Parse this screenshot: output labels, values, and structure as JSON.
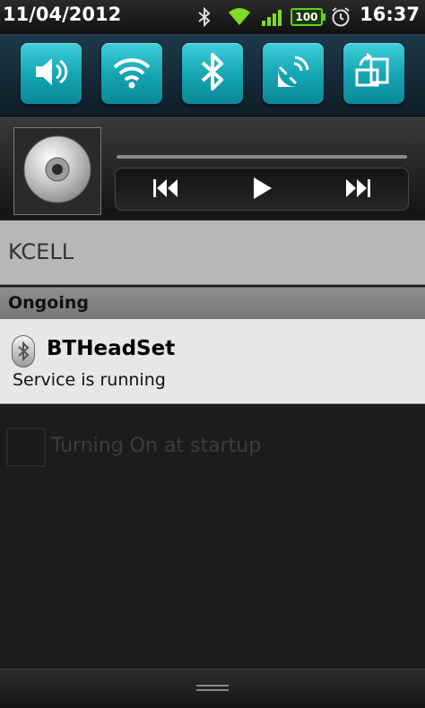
{
  "status_bar": {
    "date": "11/04/2012",
    "time": "16:37",
    "battery_level": "100",
    "icons": [
      "bluetooth-icon",
      "wifi-icon",
      "signal-icon",
      "battery-icon",
      "alarm-icon"
    ]
  },
  "quick_toggles": [
    {
      "name": "sound",
      "icon": "speaker-icon"
    },
    {
      "name": "wifi",
      "icon": "wifi-icon"
    },
    {
      "name": "bluetooth",
      "icon": "bluetooth-icon"
    },
    {
      "name": "gps",
      "icon": "satellite-icon"
    },
    {
      "name": "auto-rotate",
      "icon": "rotate-icon"
    }
  ],
  "music_widget": {
    "album_art": "cd-icon",
    "controls": [
      "previous-icon",
      "play-icon",
      "next-icon"
    ]
  },
  "carrier": "KCELL",
  "ongoing": {
    "header": "Ongoing",
    "notifications": [
      {
        "title": "BTHeadSet",
        "text": "Service is running",
        "icon": "bluetooth-icon"
      }
    ]
  },
  "background_app": {
    "checkbox_label": "Turning On at startup"
  },
  "colors": {
    "toggle_accent": "#16a6b4",
    "battery_green": "#5fd21e",
    "wifi_green": "#7ddc1f"
  }
}
